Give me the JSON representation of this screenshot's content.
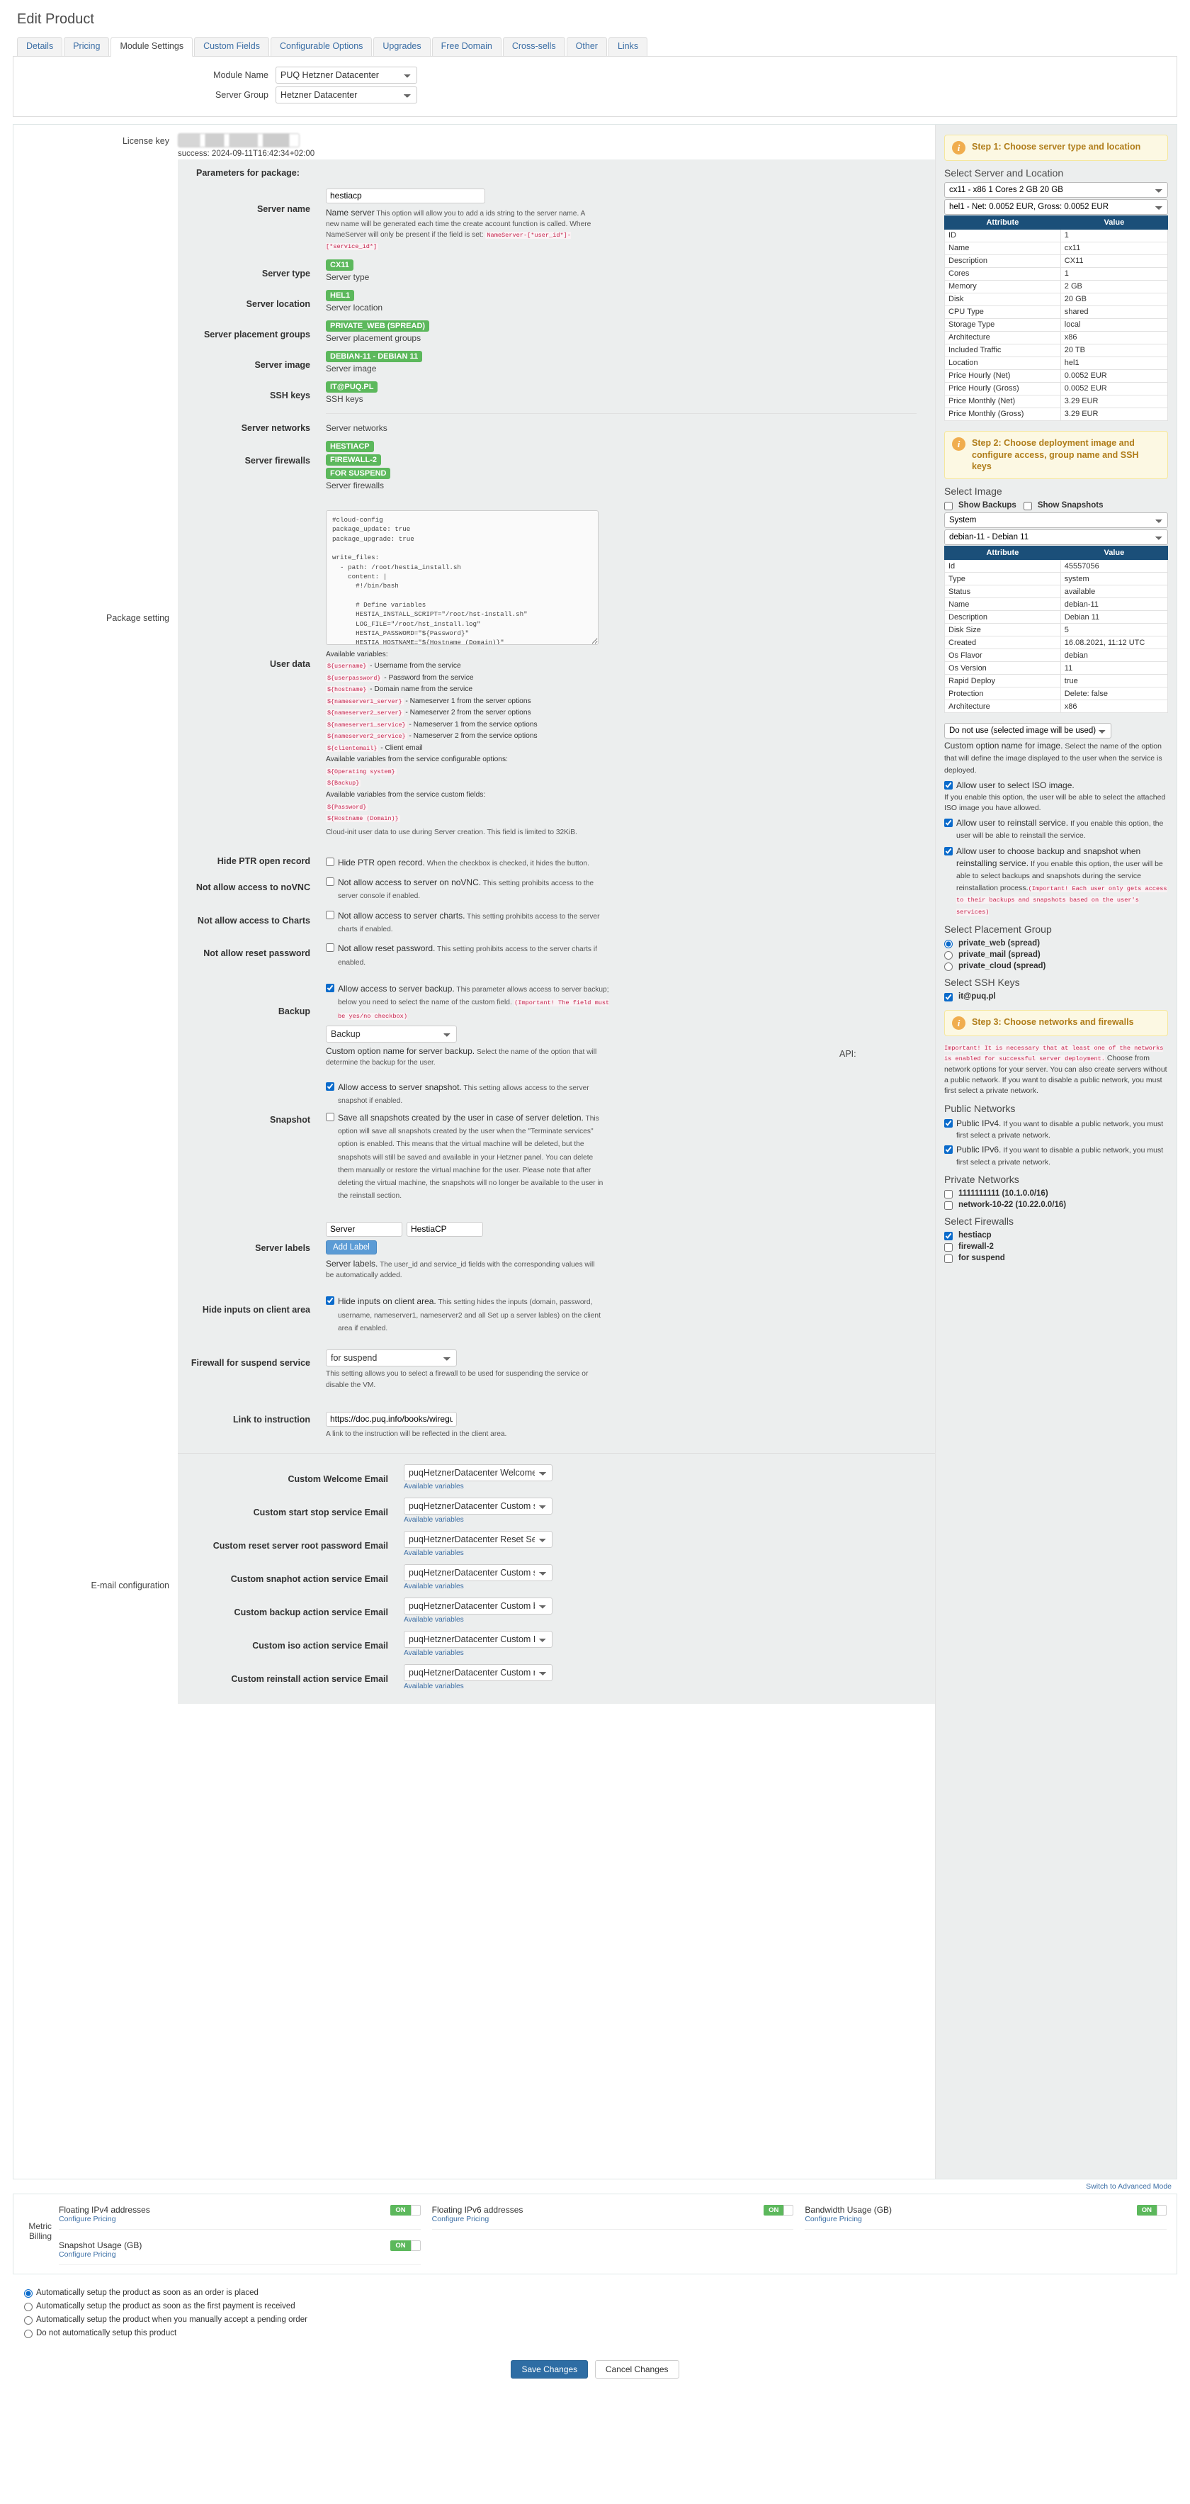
{
  "page_title": "Edit Product",
  "tabs": [
    {
      "label": "Details",
      "active": false
    },
    {
      "label": "Pricing",
      "active": false
    },
    {
      "label": "Module Settings",
      "active": true
    },
    {
      "label": "Custom Fields",
      "active": false
    },
    {
      "label": "Configurable Options",
      "active": false
    },
    {
      "label": "Upgrades",
      "active": false
    },
    {
      "label": "Free Domain",
      "active": false
    },
    {
      "label": "Cross-sells",
      "active": false
    },
    {
      "label": "Other",
      "active": false
    },
    {
      "label": "Links",
      "active": false
    }
  ],
  "module": {
    "module_name_label": "Module Name",
    "module_name_value": "PUQ Hetzner Datacenter",
    "server_group_label": "Server Group",
    "server_group_value": "Hetzner Datacenter"
  },
  "license": {
    "label": "License key",
    "status": "success: 2024-09-11T16:42:34+02:00"
  },
  "package_setting_label": "Package setting",
  "api_label": "API:",
  "params_title": "Parameters for package:",
  "fields": {
    "server_name": {
      "label": "Server name",
      "value": "hestiacp",
      "help_strong": "Name server",
      "help": " This option will allow you to add a ids string to the server name. A new name will be generated each time the create account function is called. Where NameServer  will only be present if the field is set:",
      "help_code": "NameServer-[*user_id*]-[*service_id*]"
    },
    "server_type": {
      "label": "Server type",
      "badge": "CX11",
      "caption": "Server type"
    },
    "server_location": {
      "label": "Server location",
      "badge": "HEL1",
      "caption": "Server location"
    },
    "server_placement_groups": {
      "label": "Server placement groups",
      "badge": "PRIVATE_WEB (SPREAD)",
      "caption": "Server placement groups"
    },
    "server_image": {
      "label": "Server image",
      "badge": "DEBIAN-11 - DEBIAN 11",
      "caption": "Server image"
    },
    "ssh_keys": {
      "label": "SSH keys",
      "badge": "IT@PUQ.PL",
      "caption": "SSH keys"
    },
    "server_networks": {
      "label": "Server networks",
      "caption": "Server networks"
    },
    "server_firewalls": {
      "label": "Server firewalls",
      "badges": [
        "HESTIACP",
        "FIREWALL-2",
        "FOR SUSPEND"
      ],
      "caption": "Server firewalls"
    },
    "user_data": {
      "label": "User data",
      "code": "#cloud-config\npackage_update: true\npackage_upgrade: true\n\nwrite_files:\n  - path: /root/hestia_install.sh\n    content: |\n      #!/bin/bash\n\n      # Define variables\n      HESTIA_INSTALL_SCRIPT=\"/root/hst-install.sh\"\n      LOG_FILE=\"/root/hst_install.log\"\n      HESTIA_PASSWORD=\"${Password}\"\n      HESTIA_HOSTNAME=\"${Hostname (Domain)}\"\n      HESTIA_EMAIL=\"${clientemail}\"\n\n      # Download Hestia install script\n      wget https://raw.githubusercontent.com/hestiacp/hestiacp/release/install/hst-install.sh -O $HESTIA_INSTALL_SCRIPT",
      "available_title": "Available variables:",
      "variables": [
        {
          "var": "${username}",
          "desc": "- Username from the service"
        },
        {
          "var": "${userpassword}",
          "desc": "- Password from the service"
        },
        {
          "var": "${hostname}",
          "desc": "- Domain name from the service"
        },
        {
          "var": "${nameserver1_server}",
          "desc": "- Nameserver 1 from the server options"
        },
        {
          "var": "${nameserver2_server}",
          "desc": "- Nameserver 2 from the server options"
        },
        {
          "var": "${nameserver1_service}",
          "desc": "- Nameserver 1 from the service options"
        },
        {
          "var": "${nameserver2_service}",
          "desc": "- Nameserver 2 from the service options"
        },
        {
          "var": "${clientemail}",
          "desc": "- Client email"
        }
      ],
      "config_options_title": "Available variables from the service configurable options:",
      "config_options": [
        "${Operating system}",
        "${Backup}"
      ],
      "custom_fields_title": "Available variables from the service custom fields:",
      "custom_fields": [
        "${Password}",
        "${Hostname (Domain)}"
      ],
      "footer_note": "Cloud-init user data to use during Server creation. This field is limited to 32KiB."
    },
    "hide_ptr": {
      "label": "Hide PTR open record",
      "checkbox_strong": "Hide PTR open record.",
      "checkbox_help": " When the checkbox is checked, it hides the button.",
      "checked": false
    },
    "no_novnc": {
      "label": "Not allow access to noVNC",
      "checkbox_strong": "Not allow access to server on noVNC.",
      "checkbox_help": " This setting prohibits access to the server console if enabled.",
      "checked": false
    },
    "no_charts": {
      "label": "Not allow access to Charts",
      "checkbox_strong": "Not allow access to server charts.",
      "checkbox_help": " This setting prohibits access to the server charts if enabled.",
      "checked": false
    },
    "no_reset_password": {
      "label": "Not allow reset password",
      "checkbox_strong": "Not allow reset password.",
      "checkbox_help": " This setting prohibits access to the server charts if enabled.",
      "checked": false
    },
    "backup": {
      "label": "Backup",
      "checkbox_strong": "Allow access to server backup.",
      "checkbox_help": " This parameter allows access to server backup; below you need to select the name of the custom field.",
      "warn": "(Important! The field must be yes/no checkbox)",
      "checked": true,
      "select_value": "Backup",
      "select_help_strong": "Custom option name for server backup.",
      "select_help": " Select the name of the option that will determine the backup for the user."
    },
    "snapshot": {
      "label": "Snapshot",
      "checkbox_strong": "Allow access to server snapshot.",
      "checkbox_help": " This setting allows access to the server snapshot if enabled.",
      "checked": true,
      "second_strong": "Save all snapshots created by the user in case of server deletion.",
      "second_help": " This option will save all snapshots created by the user when the \"Terminate services\" option is enabled. This means that the virtual machine will be deleted, but the snapshots will still be saved and available in your Hetzner panel. You can delete them manually or restore the virtual machine for the user. Please note that after deleting the virtual machine, the snapshots will no longer be available to the user in the reinstall section.",
      "second_checked": false
    },
    "server_labels": {
      "label": "Server labels",
      "key": "Server",
      "value": "HestiaCP",
      "button": "Add Label",
      "help_strong": "Server labels.",
      "help": " The user_id and service_id fields with the corresponding values will be automatically added."
    },
    "hide_inputs": {
      "label": "Hide inputs on client area",
      "checkbox_strong": "Hide inputs on client area.",
      "checkbox_help": " This setting hides the inputs (domain, password, username, nameserver1, nameserver2 and all Set up a server lables) on the client area if enabled.",
      "checked": true
    },
    "firewall_suspend": {
      "label": "Firewall for suspend service",
      "select_value": "for suspend",
      "help": "This setting allows you to select a firewall to be used for suspending the service or disable the VM."
    },
    "link_instruction": {
      "label": "Link to instruction",
      "value": "https://doc.puq.info/books/wireguard-vpn-s",
      "help": "A link to the instruction will be reflected in the client area."
    }
  },
  "email_config": {
    "label": "E-mail configuration",
    "available_variables": "Available variables",
    "rows": [
      {
        "label": "Custom Welcome Email",
        "value": "puqHetznerDatacenter Welcome Email"
      },
      {
        "label": "Custom start stop service Email",
        "value": "puqHetznerDatacenter Custom start/stop"
      },
      {
        "label": "Custom reset server root password Email",
        "value": "puqHetznerDatacenter Reset Service Pass"
      },
      {
        "label": "Custom snaphot action service Email",
        "value": "puqHetznerDatacenter Custom snaphot a"
      },
      {
        "label": "Custom backup action service Email",
        "value": "puqHetznerDatacenter Custom backup ac"
      },
      {
        "label": "Custom iso action service Email",
        "value": "puqHetznerDatacenter Custom ISO action"
      },
      {
        "label": "Custom reinstall action service Email",
        "value": "puqHetznerDatacenter Custom reinstall a"
      }
    ]
  },
  "right": {
    "step1": {
      "title": "Step 1: Choose server type and location",
      "section_title": "Select Server and Location",
      "server_select": "cx11 - x86 1 Cores 2 GB 20 GB",
      "location_select": "hel1 - Net: 0.0052 EUR, Gross: 0.0052 EUR",
      "table_headers": [
        "Attribute",
        "Value"
      ],
      "rows": [
        [
          "ID",
          "1"
        ],
        [
          "Name",
          "cx11"
        ],
        [
          "Description",
          "CX11"
        ],
        [
          "Cores",
          "1"
        ],
        [
          "Memory",
          "2 GB"
        ],
        [
          "Disk",
          "20 GB"
        ],
        [
          "CPU Type",
          "shared"
        ],
        [
          "Storage Type",
          "local"
        ],
        [
          "Architecture",
          "x86"
        ],
        [
          "Included Traffic",
          "20 TB"
        ],
        [
          "Location",
          "hel1"
        ],
        [
          "Price Hourly (Net)",
          "0.0052 EUR"
        ],
        [
          "Price Hourly (Gross)",
          "0.0052 EUR"
        ],
        [
          "Price Monthly (Net)",
          "3.29 EUR"
        ],
        [
          "Price Monthly (Gross)",
          "3.29 EUR"
        ]
      ]
    },
    "step2": {
      "title": "Step 2: Choose deployment image and configure access, group name and SSH keys",
      "section_title": "Select Image",
      "show_backups": "Show Backups",
      "show_snapshots": "Show Snapshots",
      "type_select": "System",
      "image_select": "debian-11 - Debian 11",
      "table_headers": [
        "Attribute",
        "Value"
      ],
      "rows": [
        [
          "Id",
          "45557056"
        ],
        [
          "Type",
          "system"
        ],
        [
          "Status",
          "available"
        ],
        [
          "Name",
          "debian-11"
        ],
        [
          "Description",
          "Debian 11"
        ],
        [
          "Disk Size",
          "5"
        ],
        [
          "Created",
          "16.08.2021, 11:12 UTC"
        ],
        [
          "Os Flavor",
          "debian"
        ],
        [
          "Os Version",
          "11"
        ],
        [
          "Rapid Deploy",
          "true"
        ],
        [
          "Protection",
          "Delete: false"
        ],
        [
          "Architecture",
          "x86"
        ]
      ],
      "custom_option_select": "Do not use (selected image will be used)",
      "custom_option_strong": "Custom option name for image.",
      "custom_option_help": " Select the name of the option that will define the image displayed to the user when the service is deployed.",
      "allow_iso_strong": "Allow user to select ISO image.",
      "allow_iso_help": "If you enable this option, the user will be able to select the attached ISO image you have allowed.",
      "allow_reinstall_strong": "Allow user to reinstall service.",
      "allow_reinstall_help": " If you enable this option, the user will be able to reinstall the service.",
      "allow_backup_strong": "Allow user to choose backup and snapshot when reinstalling service.",
      "allow_backup_help": " If you enable this option, the user will be able to select backups and snapshots during the service reinstallation process.",
      "allow_backup_warn": "(Important! Each user only gets access to their backups and snapshots based on the user's services)",
      "placement_title": "Select Placement Group",
      "placement_groups": [
        {
          "label": "private_web (spread)",
          "checked": true
        },
        {
          "label": "private_mail (spread)",
          "checked": false
        },
        {
          "label": "private_cloud (spread)",
          "checked": false
        }
      ],
      "ssh_title": "Select SSH Keys",
      "ssh_keys": [
        {
          "label": "it@puq.pl",
          "checked": true
        }
      ]
    },
    "step3": {
      "title": "Step 3: Choose networks and firewalls",
      "warn": "Important! It is necessary that at least one of the networks is enabled for successful server deployment.",
      "help": " Choose from network options for your server. You can also create servers without a public network. If you want to disable a public network, you must first select a private network.",
      "public_title": "Public Networks",
      "public": [
        {
          "strong": "Public IPv4.",
          "help": " If you want to disable a public network, you must first select a private network.",
          "checked": true
        },
        {
          "strong": "Public IPv6.",
          "help": " If you want to disable a public network, you must first select a private network.",
          "checked": true
        }
      ],
      "private_title": "Private Networks",
      "private": [
        {
          "label": "1111111111 (10.1.0.0/16)",
          "checked": false
        },
        {
          "label": "network-10-22 (10.22.0.0/16)",
          "checked": false
        }
      ],
      "firewalls_title": "Select Firewalls",
      "firewalls": [
        {
          "label": "hestiacp",
          "checked": true
        },
        {
          "label": "firewall-2",
          "checked": false
        },
        {
          "label": "for suspend",
          "checked": false
        }
      ]
    }
  },
  "bottom": {
    "switch_advanced": "Switch to Advanced Mode",
    "metric_label": "Metric Billing",
    "configure_pricing": "Configure Pricing",
    "metrics": [
      {
        "name": "Floating IPv4 addresses",
        "state": "ON"
      },
      {
        "name": "Floating IPv6 addresses",
        "state": "ON"
      },
      {
        "name": "Bandwidth Usage (GB)",
        "state": "ON"
      },
      {
        "name": "Snapshot Usage (GB)",
        "state": "ON"
      }
    ],
    "setup_options": [
      {
        "label": "Automatically setup the product as soon as an order is placed",
        "checked": true
      },
      {
        "label": "Automatically setup the product as soon as the first payment is received",
        "checked": false
      },
      {
        "label": "Automatically setup the product when you manually accept a pending order",
        "checked": false
      },
      {
        "label": "Do not automatically setup this product",
        "checked": false
      }
    ],
    "save_button": "Save Changes",
    "cancel_button": "Cancel Changes"
  }
}
